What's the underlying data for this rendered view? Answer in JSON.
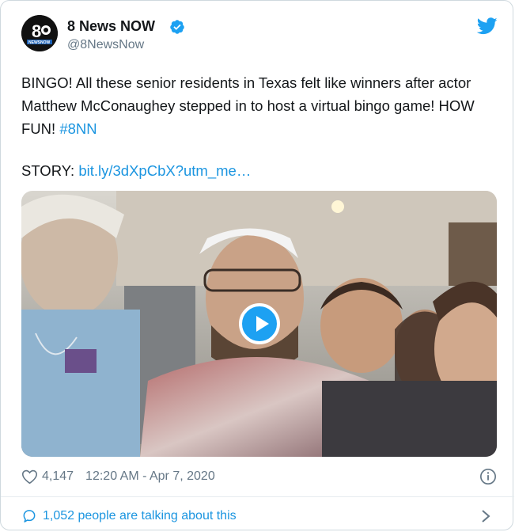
{
  "account": {
    "name": "8 News NOW",
    "handle": "@8NewsNow",
    "avatar_text": "8",
    "avatar_brand": "NEWSNOW"
  },
  "tweet": {
    "text_part1": "BINGO! All these senior residents in Texas felt like winners after actor Matthew McConaughey stepped in to host a virtual bingo game! HOW FUN! ",
    "hashtag": "#8NN",
    "story_label": "STORY: ",
    "story_link": "bit.ly/3dXpCbX?utm_me…"
  },
  "media": {
    "type": "video"
  },
  "meta": {
    "likes": "4,147",
    "timestamp": "12:20 AM - Apr 7, 2020"
  },
  "footer": {
    "talking": "1,052 people are talking about this"
  },
  "colors": {
    "link": "#1b95e0",
    "twitter_blue": "#1da1f2",
    "secondary_text": "#657786"
  },
  "icons": [
    "verified-badge-icon",
    "twitter-bird-icon",
    "play-icon",
    "heart-icon",
    "info-icon",
    "speech-bubble-icon",
    "chevron-right-icon"
  ]
}
